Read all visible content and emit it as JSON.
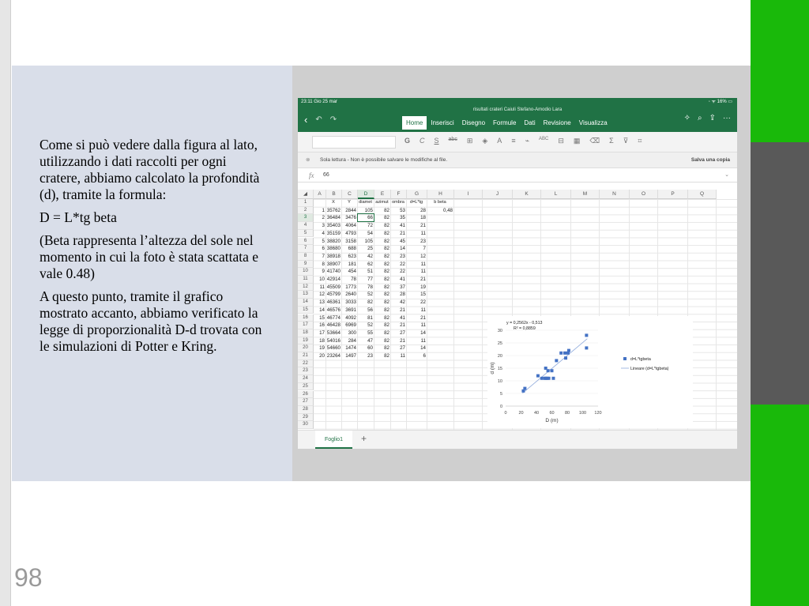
{
  "slide": {
    "page_number": "98",
    "paragraphs": [
      "Come si può vedere dalla figura al lato, utilizzando i dati raccolti per ogni cratere, abbiamo calcolato la profondità (d), tramite la formula:",
      "D = L*tg beta",
      "(Beta rappresenta l’altezza del sole nel momento in cui la foto è stata scattata e vale 0.48)",
      "A questo punto, tramite il grafico mostrato accanto, abbiamo verificato la legge di proporzionalità D-d trovata con le simulazioni di Potter e Kring."
    ]
  },
  "excel": {
    "status_left": "23:11  Gio 25 mar",
    "status_right": "◦ ᯤ 16% ▭",
    "doc_title": "risultati crateri Caiuli Stefano-Amodio Lara",
    "tabs": [
      {
        "label": "Home",
        "active": true
      },
      {
        "label": "Inserisci",
        "active": false
      },
      {
        "label": "Disegno",
        "active": false
      },
      {
        "label": "Formule",
        "active": false
      },
      {
        "label": "Dati",
        "active": false
      },
      {
        "label": "Revisione",
        "active": false
      },
      {
        "label": "Visualizza",
        "active": false
      }
    ],
    "readonly_message": "Sola lettura - Non è possibile salvare le modifiche al file.",
    "save_copy": "Salva una copia",
    "formula_value": "66",
    "formula_fx": "fx",
    "columns": [
      "A",
      "B",
      "C",
      "D",
      "E",
      "F",
      "G",
      "H",
      "I",
      "J",
      "K",
      "L",
      "M",
      "N",
      "O",
      "P",
      "Q"
    ],
    "selected_column": "D",
    "selected_row": 3,
    "row_count": 30,
    "header_row": [
      "",
      "X",
      "Y",
      "diamet",
      "azimut",
      "ombra",
      "d=L*tg",
      "b beta"
    ],
    "beta_value": "0,48",
    "rows": [
      [
        "1",
        "35762",
        "2844",
        "105",
        "82",
        "53",
        "28"
      ],
      [
        "2",
        "36484",
        "3476",
        "66",
        "82",
        "35",
        "18"
      ],
      [
        "3",
        "35403",
        "4064",
        "72",
        "82",
        "41",
        "21"
      ],
      [
        "4",
        "35159",
        "4793",
        "54",
        "82",
        "21",
        "11"
      ],
      [
        "5",
        "38820",
        "3158",
        "105",
        "82",
        "45",
        "23"
      ],
      [
        "6",
        "38680",
        "688",
        "25",
        "82",
        "14",
        "7"
      ],
      [
        "7",
        "38918",
        "623",
        "42",
        "82",
        "23",
        "12"
      ],
      [
        "8",
        "38907",
        "181",
        "62",
        "82",
        "22",
        "11"
      ],
      [
        "9",
        "41740",
        "454",
        "51",
        "82",
        "22",
        "11"
      ],
      [
        "10",
        "42914",
        "78",
        "77",
        "82",
        "41",
        "21"
      ],
      [
        "11",
        "45509",
        "1773",
        "78",
        "82",
        "37",
        "19"
      ],
      [
        "12",
        "45799",
        "2640",
        "52",
        "82",
        "28",
        "15"
      ],
      [
        "13",
        "46361",
        "3033",
        "82",
        "82",
        "42",
        "22"
      ],
      [
        "14",
        "46576",
        "3691",
        "56",
        "82",
        "21",
        "11"
      ],
      [
        "15",
        "46774",
        "4092",
        "81",
        "82",
        "41",
        "21"
      ],
      [
        "16",
        "46428",
        "6969",
        "52",
        "82",
        "21",
        "11"
      ],
      [
        "17",
        "53664",
        "300",
        "55",
        "82",
        "27",
        "14"
      ],
      [
        "18",
        "54016",
        "284",
        "47",
        "82",
        "21",
        "11"
      ],
      [
        "19",
        "54660",
        "1474",
        "60",
        "82",
        "27",
        "14"
      ],
      [
        "20",
        "23264",
        "1497",
        "23",
        "82",
        "11",
        "6"
      ]
    ],
    "sheet_tab": "Foglio1",
    "add_sheet": "+"
  },
  "chart_data": {
    "type": "scatter",
    "equation": "y = 0,2562x - 0,513",
    "r_squared": "R² = 0,8859",
    "xlabel": "D (m)",
    "ylabel": "d (m)",
    "xlim": [
      0,
      120
    ],
    "ylim": [
      0,
      30
    ],
    "xticks": [
      0,
      20,
      40,
      60,
      80,
      100,
      120
    ],
    "yticks": [
      0,
      5,
      10,
      15,
      20,
      25,
      30
    ],
    "series": [
      {
        "name": "d=L*tgbeta",
        "color": "#4472c4",
        "x": [
          105,
          66,
          72,
          54,
          105,
          25,
          42,
          62,
          51,
          77,
          78,
          52,
          82,
          56,
          81,
          52,
          55,
          47,
          60,
          23
        ],
        "y": [
          28,
          18,
          21,
          11,
          23,
          7,
          12,
          11,
          11,
          21,
          19,
          15,
          22,
          11,
          21,
          11,
          14,
          11,
          14,
          6
        ]
      }
    ],
    "trendline": {
      "name": "Lineare (d=L*tgbeta)",
      "slope": 0.2562,
      "intercept": -0.513,
      "color": "#8faadc"
    },
    "legend": "right"
  }
}
